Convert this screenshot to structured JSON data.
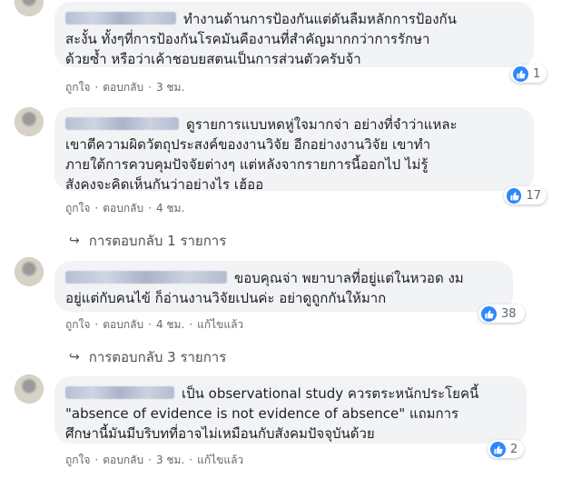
{
  "actions": {
    "like": "ถูกใจ",
    "reply": "ตอบกลับ",
    "dot": "·",
    "edited": "แก้ไขแล้ว"
  },
  "comments": [
    {
      "text": "ทำงานด้านการป้องกันแต่ดันลืมหลักการป้องกัน\nสะงั้น ทั้งๆที่การป้องกันโรคมันคืองานที่สำคัญมากกว่าการรักษา\nด้วยซ้ำ หรือว่าเค้าชอบยสตนเป็นการส่วนตัวครับจ้า",
      "time": "3 ชม.",
      "reactions": "1"
    },
    {
      "text": "ดูรายการแบบหดหู่ใจมากจ่า อย่างที่จำว่าแหละ\nเขาตีความผิดวัตถุประสงค์ของงานวิจัย อีกอย่างงานวิจัย เขาทำ\nภายใต้การควบคุมปัจจัยต่างๆ แต่หลังจากรายการนี้ออกไป ไม่รู้\nสังคงจะคิดเห็นกันว่าอย่างไร เฮ้ออ",
      "time": "4 ชม.",
      "reactions": "17",
      "replies": "การตอบกลับ 1 รายการ"
    },
    {
      "text": "ขอบคุณจ่า พยาบาลที่อยู่แต่ในหวอด งม\nอยู่แต่กับคนไข้ ก็อ่านงานวิจัยเปนค่ะ อย่าดูถูกกันให้มาก",
      "time": "4 ชม.",
      "reactions": "38",
      "replies": "การตอบกลับ 3 รายการ"
    },
    {
      "text": "เป็น observational study ควรตระหนักประโยคนี้\n\"absence of evidence is not evidence of absence\" แถมการ\nศึกษานี้มันมีบริบทที่อาจไม่เหมือนกับสังคมปัจจุบันด้วย",
      "time": "3 ชม.",
      "reactions": "2"
    }
  ]
}
